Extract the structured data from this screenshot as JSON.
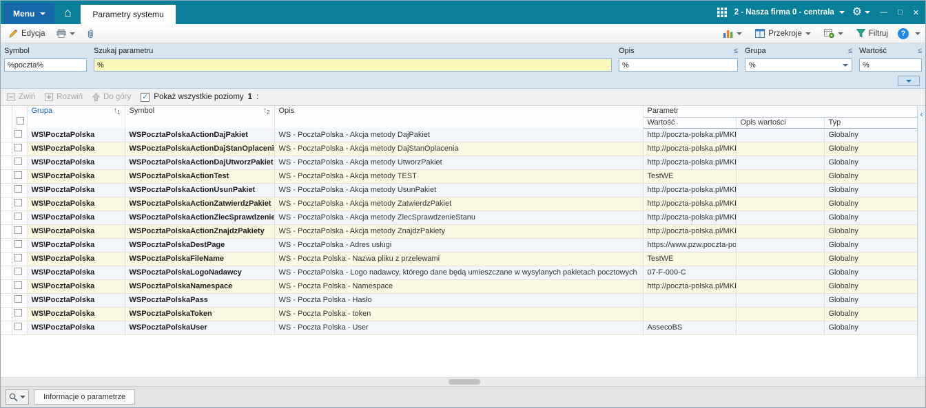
{
  "topbar": {
    "menu_label": "Menu",
    "active_tab": "Parametry systemu",
    "company": "2 - Nasza firma 0 - centrala",
    "minimize_glyph": "—",
    "maximize_glyph": "□",
    "close_glyph": "✕"
  },
  "toolbar": {
    "edit_label": "Edycja",
    "przekroje_label": "Przekroje",
    "filter_label": "Filtruj",
    "help_glyph": "?"
  },
  "filters": {
    "le_glyph": "≤",
    "symbol": {
      "label": "Symbol",
      "value": "%poczta%"
    },
    "szukaj": {
      "label": "Szukaj parametru",
      "value": "%"
    },
    "opis": {
      "label": "Opis",
      "value": "%"
    },
    "grupa": {
      "label": "Grupa",
      "value": "%"
    },
    "wartosc": {
      "label": "Wartość",
      "value": "%"
    }
  },
  "gridbar": {
    "collapse_label": "Zwiń",
    "expand_label": "Rozwiń",
    "up_label": "Do góry",
    "levels_label": "Pokaż wszystkie poziomy",
    "levels_value": "1",
    "levels_colon": ":"
  },
  "table": {
    "header": {
      "grupa": "Grupa",
      "symbol": "Symbol",
      "opis": "Opis",
      "parametr": "Parametr",
      "wartosc": "Wartość",
      "opis_wartosci": "Opis wartości",
      "typ": "Typ",
      "sort_grupa": "1",
      "sort_symbol": "2"
    },
    "rows": [
      {
        "grupa": "WS\\PocztaPolska",
        "symbol": "WSPocztaPolskaActionDajPakiet",
        "opis": "WS - PocztaPolska - Akcja metody DajPakiet",
        "wartosc": "http://poczta-polska.pl/MKI",
        "opis_wartosci": "",
        "typ": "Globalny"
      },
      {
        "grupa": "WS\\PocztaPolska",
        "symbol": "WSPocztaPolskaActionDajStanOplacenia",
        "opis": "WS - PocztaPolska - Akcja metody DajStanOplacenia",
        "wartosc": "http://poczta-polska.pl/MKI",
        "opis_wartosci": "",
        "typ": "Globalny"
      },
      {
        "grupa": "WS\\PocztaPolska",
        "symbol": "WSPocztaPolskaActionDajUtworzPakiet",
        "opis": "WS - PocztaPolska - Akcja metody UtworzPakiet",
        "wartosc": "http://poczta-polska.pl/MKI",
        "opis_wartosci": "",
        "typ": "Globalny"
      },
      {
        "grupa": "WS\\PocztaPolska",
        "symbol": "WSPocztaPolskaActionTest",
        "opis": "WS - PocztaPolska - Akcja metody TEST",
        "wartosc": "TestWE",
        "opis_wartosci": "",
        "typ": "Globalny"
      },
      {
        "grupa": "WS\\PocztaPolska",
        "symbol": "WSPocztaPolskaActionUsunPakiet",
        "opis": "WS - PocztaPolska - Akcja metody UsunPakiet",
        "wartosc": "http://poczta-polska.pl/MKI",
        "opis_wartosci": "",
        "typ": "Globalny"
      },
      {
        "grupa": "WS\\PocztaPolska",
        "symbol": "WSPocztaPolskaActionZatwierdzPakiet",
        "opis": "WS - PocztaPolska - Akcja metody ZatwierdzPakiet",
        "wartosc": "http://poczta-polska.pl/MKI",
        "opis_wartosci": "",
        "typ": "Globalny"
      },
      {
        "grupa": "WS\\PocztaPolska",
        "symbol": "WSPocztaPolskaActionZlecSprawdzenieS",
        "opis": "WS - PocztaPolska - Akcja metody ZlecSprawdzenieStanu",
        "wartosc": "http://poczta-polska.pl/MKI",
        "opis_wartosci": "",
        "typ": "Globalny"
      },
      {
        "grupa": "WS\\PocztaPolska",
        "symbol": "WSPocztaPolskaActionZnajdzPakiety",
        "opis": "WS - PocztaPolska - Akcja metody ZnajdzPakiety",
        "wartosc": "http://poczta-polska.pl/MKI",
        "opis_wartosci": "",
        "typ": "Globalny"
      },
      {
        "grupa": "WS\\PocztaPolska",
        "symbol": "WSPocztaPolskaDestPage",
        "opis": "WS - PocztaPolska - Adres usługi",
        "wartosc": "https://www.pzw.poczta-po",
        "opis_wartosci": "",
        "typ": "Globalny"
      },
      {
        "grupa": "WS\\PocztaPolska",
        "symbol": "WSPocztaPolskaFileName",
        "opis": "WS - Poczta Polska - Nazwa pliku z przelewami",
        "wartosc": "TestWE",
        "opis_wartosci": "",
        "typ": "Globalny"
      },
      {
        "grupa": "WS\\PocztaPolska",
        "symbol": "WSPocztaPolskaLogoNadawcy",
        "opis": "WS - PocztaPolska - Logo nadawcy, którego dane będą umieszczane w wysylanych pakietach pocztowych",
        "wartosc": "07-F-000-C",
        "opis_wartosci": "",
        "typ": "Globalny"
      },
      {
        "grupa": "WS\\PocztaPolska",
        "symbol": "WSPocztaPolskaNamespace",
        "opis": "WS - Poczta Polska - Namespace",
        "wartosc": "http://poczta-polska.pl/MKI",
        "opis_wartosci": "",
        "typ": "Globalny"
      },
      {
        "grupa": "WS\\PocztaPolska",
        "symbol": "WSPocztaPolskaPass",
        "opis": "WS - Poczta Polska - Hasło",
        "wartosc": "",
        "opis_wartosci": "",
        "typ": "Globalny"
      },
      {
        "grupa": "WS\\PocztaPolska",
        "symbol": "WSPocztaPolskaToken",
        "opis": "WS - Poczta Polska - token",
        "wartosc": "",
        "opis_wartosci": "",
        "typ": "Globalny"
      },
      {
        "grupa": "WS\\PocztaPolska",
        "symbol": "WSPocztaPolskaUser",
        "opis": "WS - Poczta Polska - User",
        "wartosc": "AssecoBS",
        "opis_wartosci": "",
        "typ": "Globalny"
      }
    ]
  },
  "bottombar": {
    "tab_label": "Informacje o parametrze"
  }
}
